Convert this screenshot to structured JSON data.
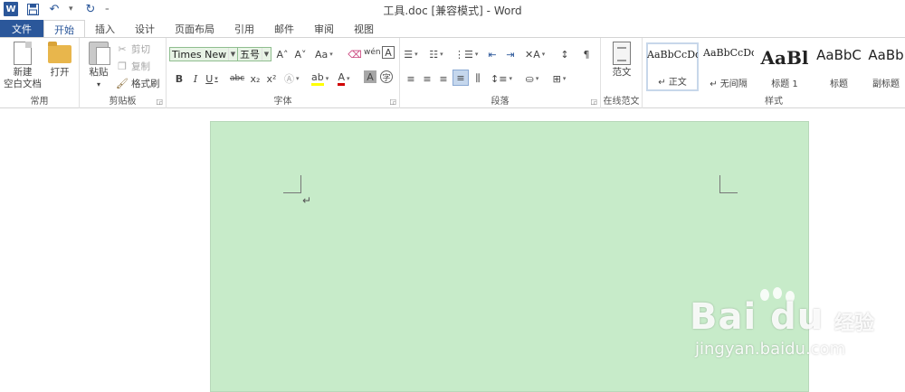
{
  "app": {
    "title": "工具.doc [兼容模式] - Word",
    "logo_letter": "W",
    "accent_color": "#2b579a",
    "page_color": "#c7ebc9"
  },
  "quick_access": {
    "icons": [
      "word-logo-icon",
      "save-icon",
      "undo-icon",
      "redo-icon",
      "customize-icon"
    ]
  },
  "tabs": [
    {
      "label": "文件"
    },
    {
      "label": "开始"
    },
    {
      "label": "插入"
    },
    {
      "label": "设计"
    },
    {
      "label": "页面布局"
    },
    {
      "label": "引用"
    },
    {
      "label": "邮件"
    },
    {
      "label": "审阅"
    },
    {
      "label": "视图"
    }
  ],
  "active_tab": "开始",
  "ribbon": {
    "common": {
      "label": "常用",
      "new_blank_line1": "新建",
      "new_blank_line2": "空白文档",
      "open": "打开"
    },
    "clipboard": {
      "label": "剪贴板",
      "paste": "粘贴",
      "cut": "剪切",
      "copy": "复制",
      "format_painter": "格式刷"
    },
    "font": {
      "label": "字体",
      "font_name": "Times New R",
      "font_size": "五号",
      "grow": "A˄",
      "shrink": "A˅",
      "change_case": "Aa",
      "bold": "B",
      "italic": "I",
      "underline": "U",
      "strike": "abc",
      "subscript": "x₂",
      "superscript": "x²",
      "char_shading": "A",
      "circle_char": "字"
    },
    "paragraph": {
      "label": "段落"
    },
    "online_templates": {
      "label": "在线范文",
      "button": "范文"
    },
    "styles": {
      "label": "样式",
      "items": [
        {
          "sample": "AaBbCcDd",
          "name": "↵ 正文"
        },
        {
          "sample": "AaBbCcDd",
          "name": "↵ 无间隔"
        },
        {
          "sample": "AaBl",
          "name": "标题 1"
        },
        {
          "sample": "AaBbC",
          "name": "标题"
        },
        {
          "sample": "AaBb",
          "name": "副标题"
        }
      ]
    }
  },
  "document": {
    "paragraph_mark": "↵"
  },
  "watermark": {
    "brand": "Bai du",
    "sub": "经验",
    "url": "jingyan.baidu.com"
  }
}
